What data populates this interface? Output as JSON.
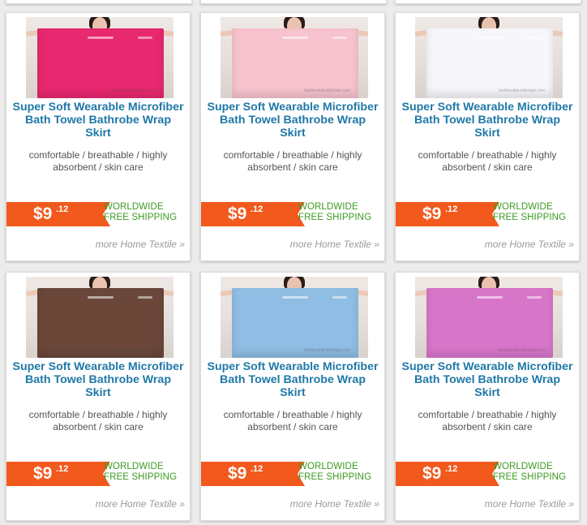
{
  "products": [
    {
      "title": "Super Soft Wearable Microfiber Bath Towel Bathrobe Wrap Skirt",
      "description": "comfortable / breathable / highly absorbent / skin care",
      "price_main": "$9",
      "price_cents": ".12",
      "shipping_line1": "WORLDWIDE",
      "shipping_line2": "FREE SHIPPING",
      "more_link": "more Home Textile »",
      "towel_color": "#e8286f",
      "photo_watermark": "fashionable.kikichain.com"
    },
    {
      "title": "Super Soft Wearable Microfiber Bath Towel Bathrobe Wrap Skirt",
      "description": "comfortable / breathable / highly absorbent / skin care",
      "price_main": "$9",
      "price_cents": ".12",
      "shipping_line1": "WORLDWIDE",
      "shipping_line2": "FREE SHIPPING",
      "more_link": "more Home Textile »",
      "towel_color": "#f6c3ce",
      "photo_watermark": "fashionable.kikichain.com"
    },
    {
      "title": "Super Soft Wearable Microfiber Bath Towel Bathrobe Wrap Skirt",
      "description": "comfortable / breathable / highly absorbent / skin care",
      "price_main": "$9",
      "price_cents": ".12",
      "shipping_line1": "WORLDWIDE",
      "shipping_line2": "FREE SHIPPING",
      "more_link": "more Home Textile »",
      "towel_color": "#f7f7fb",
      "photo_watermark": "fashionable.kikichain.com"
    },
    {
      "title": "Super Soft Wearable Microfiber Bath Towel Bathrobe Wrap Skirt",
      "description": "comfortable / breathable / highly absorbent / skin care",
      "price_main": "$9",
      "price_cents": ".12",
      "shipping_line1": "WORLDWIDE",
      "shipping_line2": "FREE SHIPPING",
      "more_link": "more Home Textile »",
      "towel_color": "#6b473a",
      "photo_watermark": "fashionable.kikichain.com"
    },
    {
      "title": "Super Soft Wearable Microfiber Bath Towel Bathrobe Wrap Skirt",
      "description": "comfortable / breathable / highly absorbent / skin care",
      "price_main": "$9",
      "price_cents": ".12",
      "shipping_line1": "WORLDWIDE",
      "shipping_line2": "FREE SHIPPING",
      "more_link": "more Home Textile »",
      "towel_color": "#8fbde3",
      "photo_watermark": "fashionable.kikichain.com"
    },
    {
      "title": "Super Soft Wearable Microfiber Bath Towel Bathrobe Wrap Skirt",
      "description": "comfortable / breathable / highly absorbent / skin care",
      "price_main": "$9",
      "price_cents": ".12",
      "shipping_line1": "WORLDWIDE",
      "shipping_line2": "FREE SHIPPING",
      "more_link": "more Home Textile »",
      "towel_color": "#d776c9",
      "photo_watermark": "fashionable.kikichain.com"
    }
  ],
  "colors": {
    "title": "#1f78a7",
    "price_bg": "#f1591d",
    "shipping": "#3c9a20",
    "more_link": "#9a9a9a"
  }
}
